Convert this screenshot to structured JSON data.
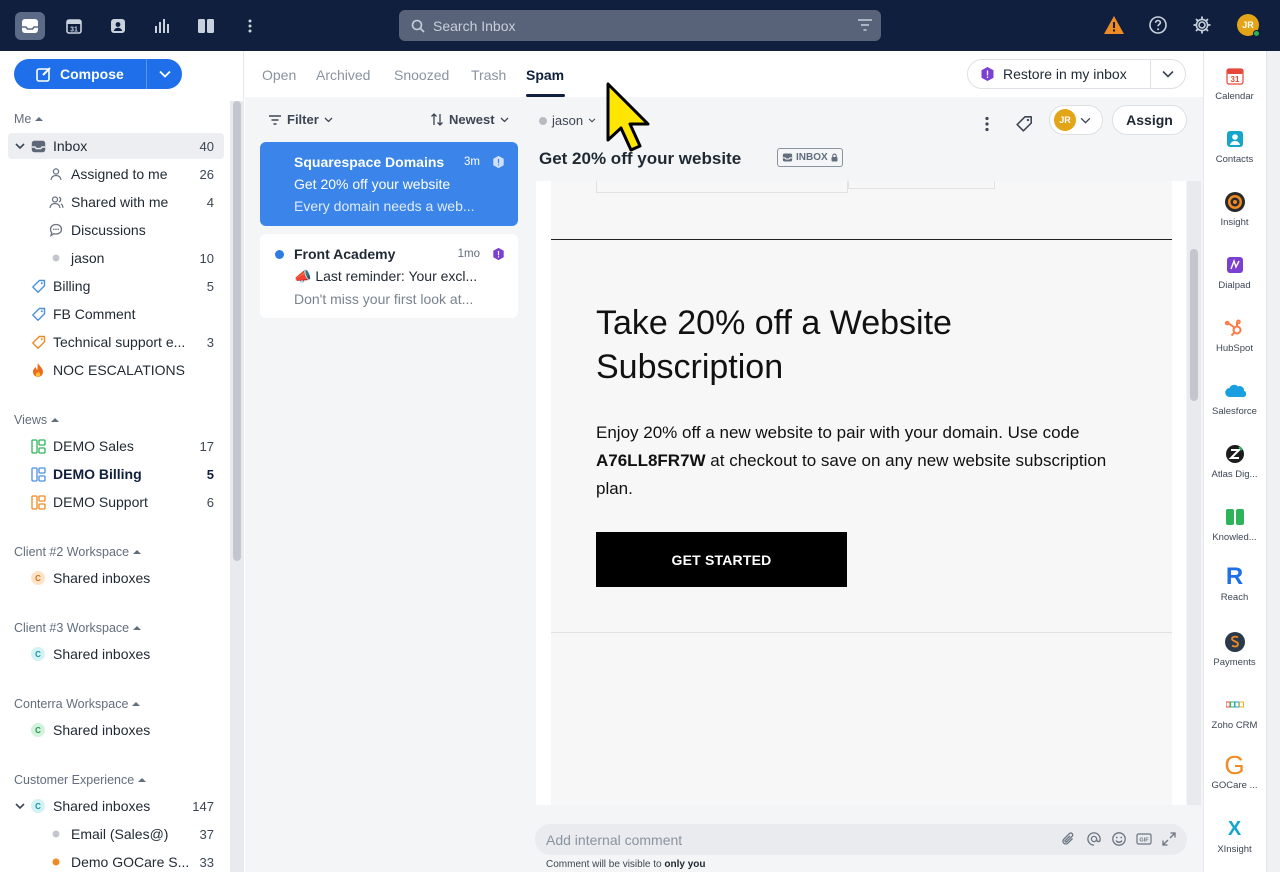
{
  "search": {
    "placeholder": "Search Inbox"
  },
  "topbar": {
    "user_initials": "JR"
  },
  "compose": {
    "label": "Compose"
  },
  "sidebar": {
    "me_header": "Me",
    "items": [
      {
        "label": "Inbox",
        "count": "40"
      },
      {
        "label": "Assigned to me",
        "count": "26"
      },
      {
        "label": "Shared with me",
        "count": "4"
      },
      {
        "label": "Discussions",
        "count": ""
      },
      {
        "label": "jason",
        "count": "10"
      },
      {
        "label": "Billing",
        "count": "5"
      },
      {
        "label": "FB Comment",
        "count": ""
      },
      {
        "label": "Technical support e...",
        "count": "3"
      },
      {
        "label": "NOC ESCALATIONS",
        "count": ""
      }
    ],
    "views_header": "Views",
    "views": [
      {
        "label": "DEMO Sales",
        "count": "17"
      },
      {
        "label": "DEMO Billing",
        "count": "5"
      },
      {
        "label": "DEMO Support",
        "count": "6"
      }
    ],
    "workspaces": [
      {
        "header": "Client #2 Workspace",
        "item": "Shared inboxes",
        "badge": "C"
      },
      {
        "header": "Client #3 Workspace",
        "item": "Shared inboxes",
        "badge": "C"
      },
      {
        "header": "Conterra Workspace",
        "item": "Shared inboxes",
        "badge": "C"
      },
      {
        "header": "Customer Experience",
        "item": "Shared inboxes",
        "badge": "C",
        "count": "147"
      }
    ],
    "cx_children": [
      {
        "label": "Email (Sales@)",
        "count": "37"
      },
      {
        "label": "Demo GOCare S...",
        "count": "33"
      }
    ]
  },
  "tabs": [
    "Open",
    "Archived",
    "Snoozed",
    "Trash",
    "Spam"
  ],
  "restore": {
    "label": "Restore in my inbox"
  },
  "list": {
    "filter_label": "Filter",
    "sort_label": "Newest",
    "messages": [
      {
        "from": "Squarespace Domains",
        "time": "3m",
        "subject": "Get 20% off your website",
        "preview": "Every domain needs a web..."
      },
      {
        "from": "Front Academy",
        "time": "1mo",
        "subject": "📣 Last reminder: Your excl...",
        "preview": "Don't miss your first look at..."
      }
    ]
  },
  "conversation": {
    "assignee": "jason",
    "title": "Get 20% off your website",
    "tag": "INBOX",
    "assign_label": "Assign",
    "avatar_initials": "JR"
  },
  "email": {
    "heading": "Take 20% off a Website Subscription",
    "body_pre": "Enjoy 20% off a new website to pair with your domain. Use code ",
    "code": "A76LL8FR7W",
    "body_post": " at checkout to save on any new website subscription plan.",
    "cta": "GET STARTED"
  },
  "comment": {
    "placeholder": "Add internal comment",
    "note_pre": "Comment will be visible to ",
    "note_bold": "only you"
  },
  "apps": [
    "Calendar",
    "Contacts",
    "Insight",
    "Dialpad",
    "HubSpot",
    "Salesforce",
    "Atlas Dig...",
    "Knowled...",
    "Reach",
    "Payments",
    "Zoho CRM",
    "GOCare ...",
    "XInsight"
  ],
  "colors": {
    "accent": "#1f6feb",
    "topbar": "#0f1f3d",
    "selected_card": "#3a84ea",
    "spam_shield": "#7b3fd1",
    "warning": "#f08a24"
  }
}
